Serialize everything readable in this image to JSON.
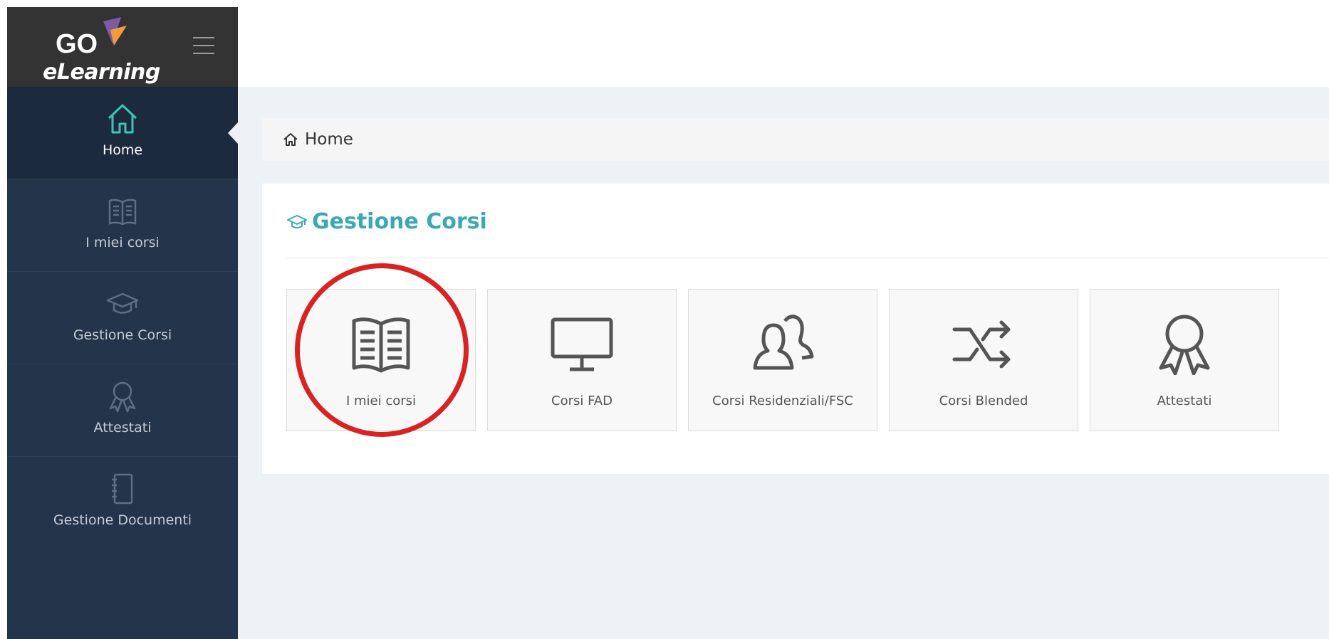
{
  "brand": {
    "logo_go": "GO",
    "logo_text": "eLearning"
  },
  "sidebar": {
    "items": [
      {
        "label": "Home",
        "icon": "home-icon",
        "active": true
      },
      {
        "label": "I miei corsi",
        "icon": "book-icon",
        "active": false
      },
      {
        "label": "Gestione Corsi",
        "icon": "graduation-cap-icon",
        "active": false
      },
      {
        "label": "Attestati",
        "icon": "award-icon",
        "active": false
      },
      {
        "label": "Gestione Documenti",
        "icon": "notebook-icon",
        "active": false
      }
    ]
  },
  "breadcrumb": {
    "label": "Home"
  },
  "panel": {
    "title": "Gestione Corsi",
    "tiles": [
      {
        "label": "I miei corsi",
        "icon": "open-book-icon",
        "highlighted": true
      },
      {
        "label": "Corsi FAD",
        "icon": "monitor-icon",
        "highlighted": false
      },
      {
        "label": "Corsi Residenziali/FSC",
        "icon": "users-icon",
        "highlighted": false
      },
      {
        "label": "Corsi Blended",
        "icon": "shuffle-icon",
        "highlighted": false
      },
      {
        "label": "Attestati",
        "icon": "award-icon",
        "highlighted": false
      }
    ]
  },
  "colors": {
    "sidebar_bg": "#24344a",
    "sidebar_active_bg": "#1c2a3d",
    "logo_bar_bg": "#333333",
    "accent_teal": "#3aa9b5",
    "highlight_red": "#d92323",
    "content_bg": "#eef1f5"
  }
}
